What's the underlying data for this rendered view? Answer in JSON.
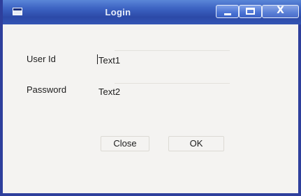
{
  "window": {
    "title": "Login",
    "controls": {
      "minimize_icon": "minimize-icon",
      "maximize_icon": "maximize-icon",
      "close_icon": "close-icon",
      "close_glyph": "X"
    }
  },
  "form": {
    "user_id": {
      "label": "User Id",
      "value": "Text1"
    },
    "password": {
      "label": "Password",
      "value": "Text2"
    }
  },
  "buttons": {
    "close_label": "Close",
    "ok_label": "OK"
  },
  "colors": {
    "titlebar": "#3c62c2",
    "frame": "#2e3f9c",
    "background": "#f4f3f1"
  }
}
